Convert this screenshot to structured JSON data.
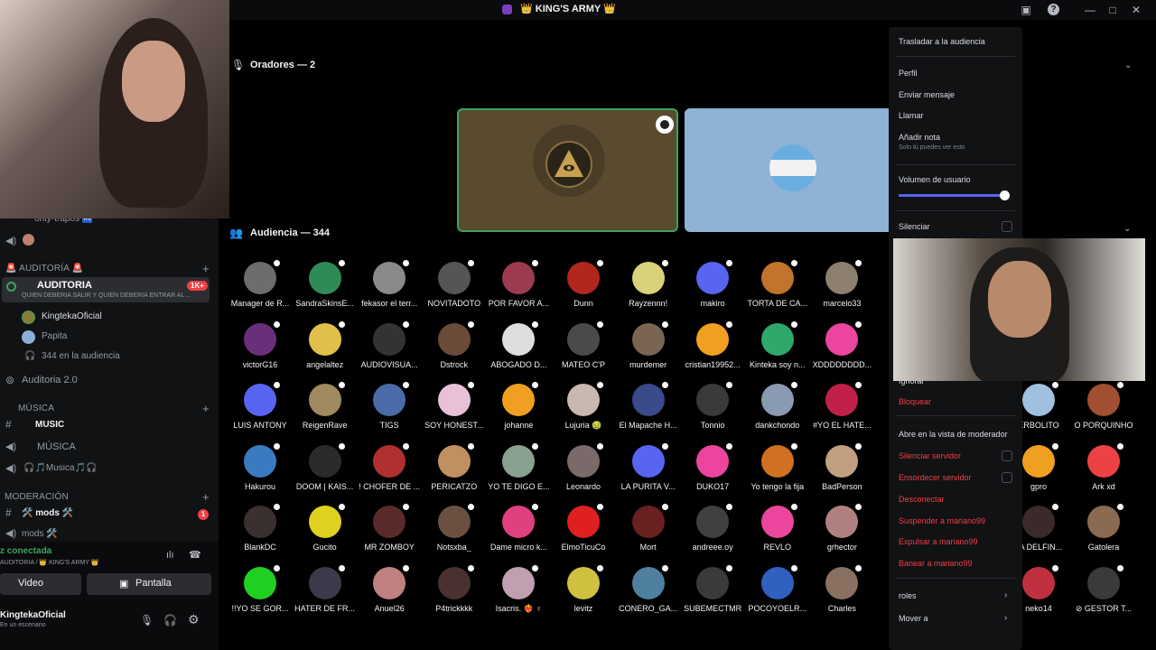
{
  "window": {
    "title": "👑 KING'S ARMY 👑"
  },
  "sidebar": {
    "channel_above": "onty-trapos 🚾",
    "cat_auditoria": "AUDITORÍA 🚨",
    "stage_name": "AUDITORIA",
    "stage_badge": "1K+",
    "stage_topic": "QUIEN DEBERIA SALIR Y QUIEN DEBERIA ENTRAR AL ...",
    "speakers": [
      "KingtekaOficial",
      "Papita"
    ],
    "audience_count": "344 en la audiencia",
    "auditoria2": "Auditoria 2.0",
    "cat_musica": "MÚSICA",
    "ch_music_text": "MUSIC",
    "ch_musica_voice": "MÚSICA",
    "ch_musica2": "🎧🎵Musica🎵🎧",
    "cat_moderacion": "MODERACIÓN",
    "ch_mods": "🛠️ mods 🛠️",
    "ch_mods_badge": "1",
    "ch_mods_voice": "mods 🛠️",
    "voice_status": "z conectada",
    "voice_location": "AUDITORIA / 👑 KING'S ARMY 👑",
    "video_btn": "Video",
    "screen_btn": "Pantalla",
    "user_name": "KingtekaOficial",
    "user_status": "En un escenario"
  },
  "stage": {
    "speakers_header": "Oradores — 2",
    "audience_header": "Audiencia — 344"
  },
  "audience": [
    {
      "name": "Manager de R...",
      "color": "#6d6d6d"
    },
    {
      "name": "SandraSkinsE...",
      "color": "#2e8b57"
    },
    {
      "name": "fekasor el terr...",
      "color": "#8a8a8a"
    },
    {
      "name": "NOVITADOTO",
      "color": "#555555"
    },
    {
      "name": "POR FAVOR A...",
      "color": "#9c3b4f"
    },
    {
      "name": "Dunn",
      "color": "#b3261e"
    },
    {
      "name": "Rayzennn!",
      "color": "#d9d27a"
    },
    {
      "name": "makiro",
      "color": "#5865f2"
    },
    {
      "name": "TORTA DE CA...",
      "color": "#c0742c"
    },
    {
      "name": "marcelo33",
      "color": "#8c7f70"
    },
    {
      "name": "victorG16",
      "color": "#6a2f7a"
    },
    {
      "name": "angelaltez",
      "color": "#e0c04a"
    },
    {
      "name": "AUDIOVISUA...",
      "color": "#333333"
    },
    {
      "name": "Dstrock",
      "color": "#6b4a3a"
    },
    {
      "name": "ABOGADO D...",
      "color": "#dddddd"
    },
    {
      "name": "MATEO C'P",
      "color": "#4a4a4a"
    },
    {
      "name": "murdemer",
      "color": "#7a6552"
    },
    {
      "name": "cristian19952...",
      "color": "#f0a020"
    },
    {
      "name": "Kinteka soy n...",
      "color": "#2ea86b"
    },
    {
      "name": "XDDDDDDDD...",
      "color": "#eb459e"
    },
    {
      "name": "LUIS ANTONY",
      "color": "#5865f2"
    },
    {
      "name": "ReigenRave",
      "color": "#a08a60"
    },
    {
      "name": "TIGS",
      "color": "#4a6aa8"
    },
    {
      "name": "SOY HONEST...",
      "color": "#e8c0d8"
    },
    {
      "name": "johanne",
      "color": "#f0a020"
    },
    {
      "name": "Lujuria 🤢",
      "color": "#c7b8b0"
    },
    {
      "name": "El Mapache H...",
      "color": "#3a4a8a"
    },
    {
      "name": "Tonnio",
      "color": "#3a3a3a"
    },
    {
      "name": "dankchondo",
      "color": "#8a9ab0"
    },
    {
      "name": "#YO EL HATE...",
      "color": "#c0204a"
    },
    {
      "name": "Hakurou",
      "color": "#3a7ac0"
    },
    {
      "name": "DOOM | KAIS...",
      "color": "#2a2a2a"
    },
    {
      "name": "! CHOFER DE ...",
      "color": "#b03030"
    },
    {
      "name": "PERICATZO",
      "color": "#c09060"
    },
    {
      "name": "YO TE DIGO E...",
      "color": "#8aa090"
    },
    {
      "name": "Leonardo",
      "color": "#7a6a6a"
    },
    {
      "name": "LA PURITA V...",
      "color": "#5865f2"
    },
    {
      "name": "DUKO17",
      "color": "#eb459e"
    },
    {
      "name": "Yo tengo la fija",
      "color": "#d07020"
    },
    {
      "name": "BadPerson",
      "color": "#c0a080"
    },
    {
      "name": "BlankDC",
      "color": "#3a3030"
    },
    {
      "name": "Gucito",
      "color": "#e0d020"
    },
    {
      "name": "MR ZOMBOY",
      "color": "#5a2a2a"
    },
    {
      "name": "Notsxba_",
      "color": "#6a5040"
    },
    {
      "name": "Dame micro k...",
      "color": "#e04080"
    },
    {
      "name": "ElmoTicuCo",
      "color": "#e02020"
    },
    {
      "name": "Mort",
      "color": "#6a2020"
    },
    {
      "name": "andreee.oy",
      "color": "#404040"
    },
    {
      "name": "REVLO",
      "color": "#eb459e"
    },
    {
      "name": "grhector",
      "color": "#b08080"
    },
    {
      "name": "!!YO SE GOR...",
      "color": "#20d020"
    },
    {
      "name": "HATER DE FR...",
      "color": "#3a3a4a"
    },
    {
      "name": "Anuel26",
      "color": "#c08080"
    },
    {
      "name": "P4trickkkk",
      "color": "#4a3030"
    },
    {
      "name": "Isacris. ❤️‍🔥 ♀",
      "color": "#c0a0b0"
    },
    {
      "name": "levitz",
      "color": "#d0c040"
    },
    {
      "name": "CONERO_GA...",
      "color": "#5080a0"
    },
    {
      "name": "SUBEMECTMR",
      "color": "#3a3a3a"
    },
    {
      "name": "POCOYOELR...",
      "color": "#3060c0"
    },
    {
      "name": "Charles",
      "color": "#8a7060"
    }
  ],
  "audience_right": [
    {
      "name": "ERBOLITO",
      "color": "#a0c0e0"
    },
    {
      "name": "O PORQUINHO",
      "color": "#a05030"
    },
    {
      "name": "gpro",
      "color": "#f0a020"
    },
    {
      "name": "Ark xd",
      "color": "#ed4245"
    },
    {
      "name": "TA DELFIN...",
      "color": "#3a2a2a"
    },
    {
      "name": "Gatolera",
      "color": "#8a6a50"
    },
    {
      "name": "neko14",
      "color": "#c03040"
    },
    {
      "name": "⊘ GESTOR T...",
      "color": "#3a3a3a"
    }
  ],
  "context_menu": {
    "move_audience": "Trasladar a la audiencia",
    "profile": "Perfil",
    "send_message": "Enviar mensaje",
    "call": "Llamar",
    "add_note": "Añadir nota",
    "add_note_sub": "Solo tú puedes ver esto",
    "user_volume": "Volumen de usuario",
    "user_volume_level": 0.95,
    "mute": "Silenciar",
    "ignore": "Ignorar",
    "block": "Bloquear",
    "open_mod_view": "Abre en la vista de moderador",
    "server_mute": "Silenciar servidor",
    "server_deafen": "Ensordecer servidor",
    "disconnect": "Desconectar",
    "suspend": "Suspender a mariano99",
    "kick": "Expulsar a mariano99",
    "ban": "Banear a mariano99",
    "roles": "roles",
    "move_to": "Mover a"
  },
  "colors": {
    "accent": "#5865f2",
    "danger": "#f23f43",
    "speaking": "#3ba55d"
  }
}
